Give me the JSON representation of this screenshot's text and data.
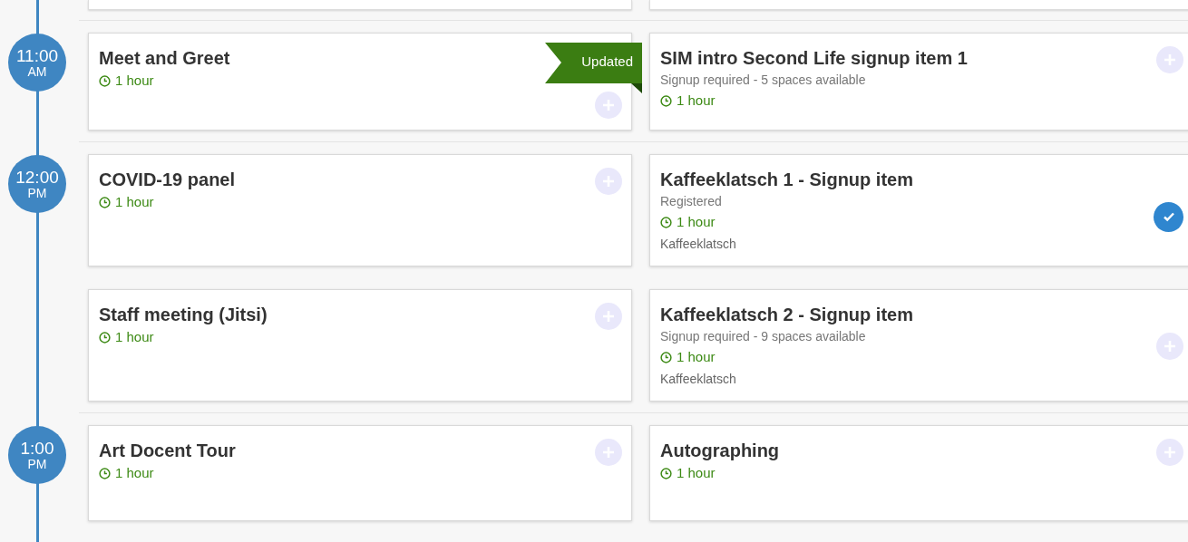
{
  "partial_row": [
    {
      "kind": "cut-card"
    },
    {
      "kind": "cut-card"
    }
  ],
  "slots": [
    {
      "time": "11:00",
      "period": "AM",
      "events": [
        {
          "title": "Meet and Greet",
          "duration": "1 hour",
          "ribbon": "Updated",
          "registered": false
        },
        {
          "title": "SIM intro Second Life signup item 1",
          "note": "Signup required - 5 spaces available",
          "duration": "1 hour",
          "registered": false
        }
      ]
    },
    {
      "time": "12:00",
      "period": "PM",
      "events": [
        {
          "title": "COVID-19 panel",
          "duration": "1 hour",
          "registered": false
        },
        {
          "title": "Kaffeeklatsch 1 - Signup item",
          "note": "Registered",
          "duration": "1 hour",
          "category": "Kaffeeklatsch",
          "registered": true
        },
        {
          "title": "Staff meeting (Jitsi)",
          "duration": "1 hour",
          "registered": false
        },
        {
          "title": "Kaffeeklatsch 2 - Signup item",
          "note": "Signup required - 9 spaces available",
          "duration": "1 hour",
          "category": "Kaffeeklatsch",
          "registered": false
        }
      ]
    },
    {
      "time": "1:00",
      "period": "PM",
      "events": [
        {
          "title": "Art Docent Tour",
          "duration": "1 hour",
          "registered": false
        },
        {
          "title": "Autographing",
          "duration": "1 hour",
          "registered": false
        }
      ]
    }
  ]
}
